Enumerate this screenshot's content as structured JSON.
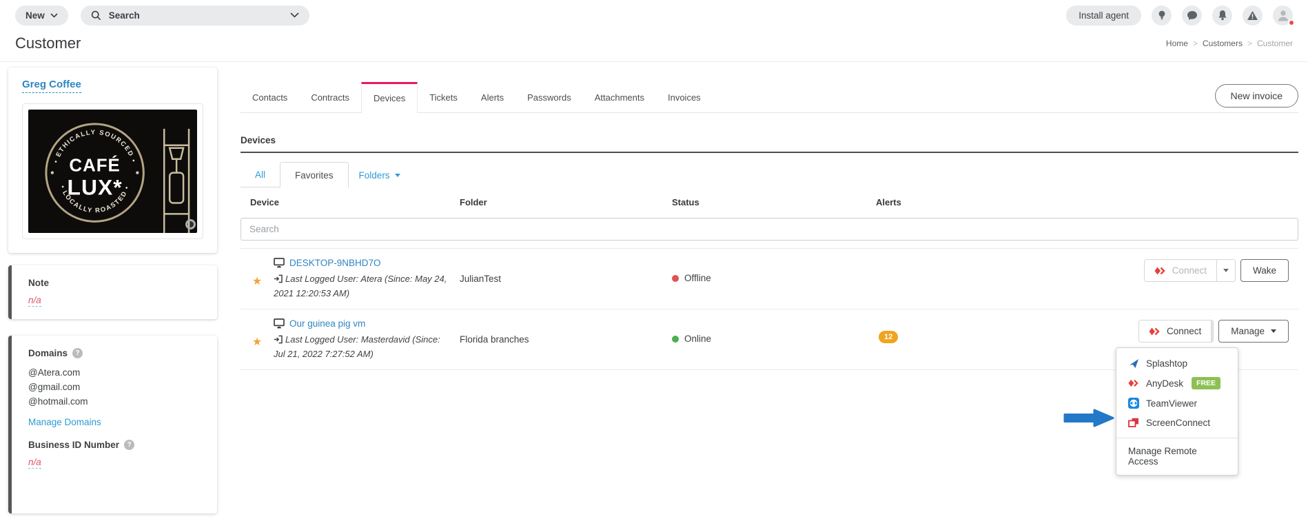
{
  "topbar": {
    "new_button_label": "New",
    "search_placeholder": "Search",
    "install_agent_label": "Install agent"
  },
  "page_header": {
    "title": "Customer",
    "breadcrumb": {
      "home": "Home",
      "customers": "Customers",
      "current": "Customer"
    }
  },
  "sidebar": {
    "customer_name": "Greg Coffee",
    "logo": {
      "arc_top": "• ETHICALLY SOURCED •",
      "name_line1": "CAFÉ",
      "name_line2": "LUX*",
      "arc_bottom": "• LOCALLY ROASTED •"
    },
    "note": {
      "label": "Note",
      "value": "n/a"
    },
    "domains": {
      "label": "Domains",
      "items": [
        "@Atera.com",
        "@gmail.com",
        "@hotmail.com"
      ],
      "manage_link": "Manage Domains"
    },
    "business_id": {
      "label": "Business ID Number",
      "value": "n/a"
    }
  },
  "tabs": {
    "items": [
      "Contacts",
      "Contracts",
      "Devices",
      "Tickets",
      "Alerts",
      "Passwords",
      "Attachments",
      "Invoices"
    ],
    "active": "Devices"
  },
  "actions": {
    "new_invoice_label": "New invoice"
  },
  "devices": {
    "section_title": "Devices",
    "subtabs": {
      "all": "All",
      "favorites": "Favorites",
      "folders": "Folders"
    },
    "active_subtab": "Favorites",
    "columns": {
      "device": "Device",
      "folder": "Folder",
      "status": "Status",
      "alerts": "Alerts"
    },
    "search_placeholder": "Search",
    "rows": [
      {
        "name": "DESKTOP-9NBHD7O",
        "last_logged": "Last Logged User: Atera (Since: May 24, 2021 12:20:53 AM)",
        "folder": "JulianTest",
        "status": "Offline",
        "alerts_count": "",
        "connect_label": "Connect",
        "secondary_label": "Wake"
      },
      {
        "name": "Our guinea pig vm",
        "last_logged": "Last Logged User: Masterdavid (Since: Jul 21, 2022 7:27:52 AM)",
        "folder": "Florida branches",
        "status": "Online",
        "alerts_count": "12",
        "connect_label": "Connect",
        "secondary_label": "Manage"
      }
    ]
  },
  "connect_menu": {
    "items": [
      {
        "label": "Splashtop",
        "icon": "splashtop-icon"
      },
      {
        "label": "AnyDesk",
        "icon": "anydesk-icon",
        "badge": "FREE"
      },
      {
        "label": "TeamViewer",
        "icon": "teamviewer-icon"
      },
      {
        "label": "ScreenConnect",
        "icon": "screenconnect-icon"
      }
    ],
    "footer": "Manage Remote Access"
  },
  "colors": {
    "accent_pink": "#eb1764",
    "link_blue": "#2e86c1",
    "light_link_blue": "#2e9bd6",
    "offline_red": "#e05252",
    "online_green": "#4caf50",
    "alert_badge_orange": "#f0a41f",
    "free_badge_green": "#8dc054",
    "arrow_blue": "#2478c8",
    "na_red": "#e0566b",
    "star_orange": "#f2a33c"
  }
}
